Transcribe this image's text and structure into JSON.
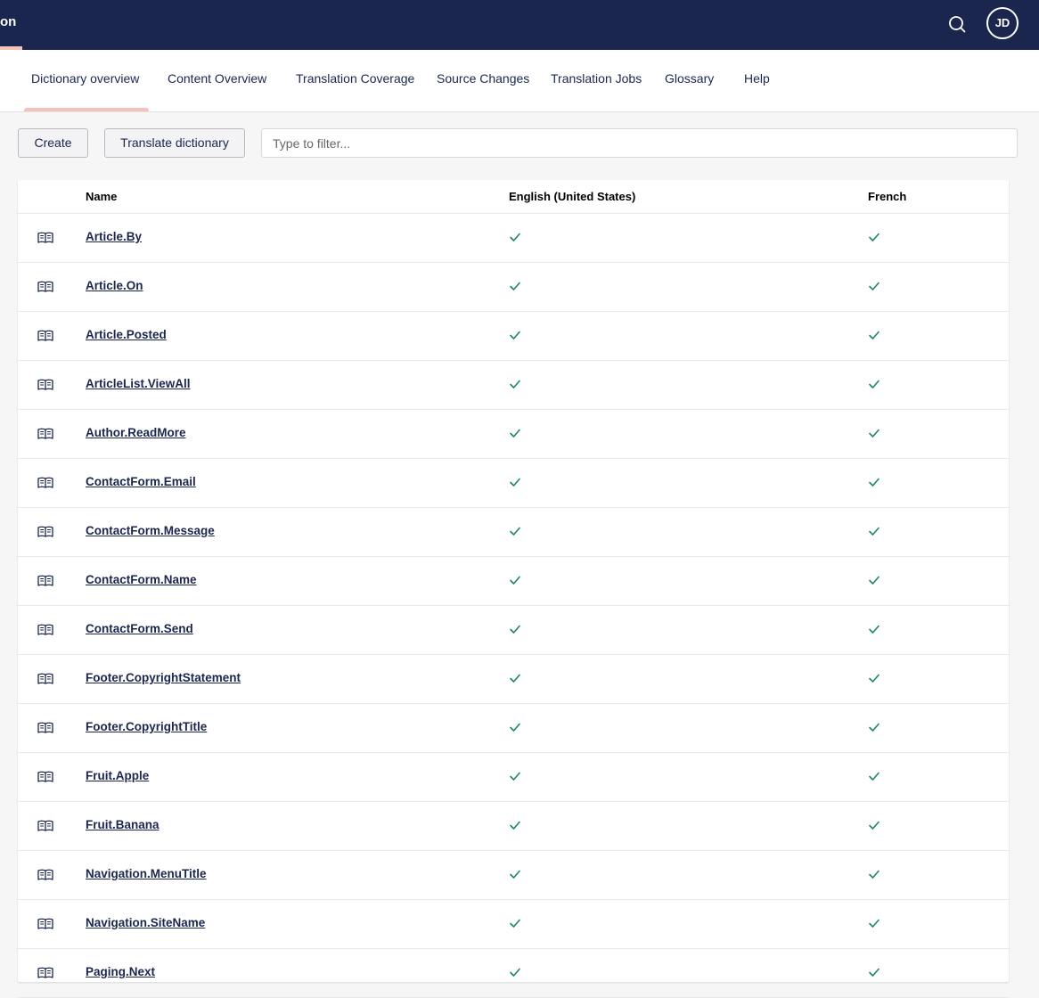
{
  "header": {
    "app_title": "on",
    "avatar_initials": "JD",
    "search_icon": "search-icon"
  },
  "tabs": [
    {
      "label": "Dictionary overview",
      "active": true
    },
    {
      "label": "Content Overview"
    },
    {
      "label": "Translation Coverage"
    },
    {
      "label": "Source Changes"
    },
    {
      "label": "Translation Jobs"
    },
    {
      "label": "Glossary"
    },
    {
      "label": "Help"
    }
  ],
  "toolbar": {
    "create_label": "Create",
    "translate_label": "Translate dictionary",
    "filter_placeholder": "Type to filter..."
  },
  "table": {
    "columns": [
      "Name",
      "English (United States)",
      "French"
    ],
    "rows": [
      {
        "name": "Article.By",
        "english": true,
        "french": true
      },
      {
        "name": "Article.On",
        "english": true,
        "french": true
      },
      {
        "name": "Article.Posted",
        "english": true,
        "french": true
      },
      {
        "name": "ArticleList.ViewAll",
        "english": true,
        "french": true
      },
      {
        "name": "Author.ReadMore",
        "english": true,
        "french": true
      },
      {
        "name": "ContactForm.Email",
        "english": true,
        "french": true
      },
      {
        "name": "ContactForm.Message",
        "english": true,
        "french": true
      },
      {
        "name": "ContactForm.Name",
        "english": true,
        "french": true
      },
      {
        "name": "ContactForm.Send",
        "english": true,
        "french": true
      },
      {
        "name": "Footer.CopyrightStatement",
        "english": true,
        "french": true
      },
      {
        "name": "Footer.CopyrightTitle",
        "english": true,
        "french": true
      },
      {
        "name": "Fruit.Apple",
        "english": true,
        "french": true
      },
      {
        "name": "Fruit.Banana",
        "english": true,
        "french": true
      },
      {
        "name": "Navigation.MenuTitle",
        "english": true,
        "french": true
      },
      {
        "name": "Navigation.SiteName",
        "english": true,
        "french": true
      },
      {
        "name": "Paging.Next",
        "english": true,
        "french": true
      }
    ]
  },
  "colors": {
    "header_bg": "#1b264f",
    "accent": "#f5c1bc",
    "check": "#2bc37c"
  }
}
